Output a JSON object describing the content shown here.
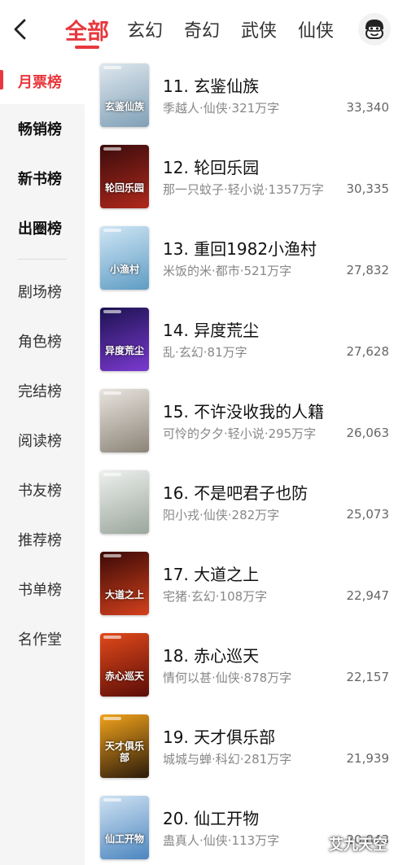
{
  "header": {
    "tabs": [
      {
        "label": "全部",
        "active": true
      },
      {
        "label": "玄幻",
        "active": false
      },
      {
        "label": "奇幻",
        "active": false
      },
      {
        "label": "武侠",
        "active": false
      },
      {
        "label": "仙侠",
        "active": false
      }
    ],
    "back_icon": "chevron-left-icon",
    "avatar_icon": "mascot-face-icon"
  },
  "sidebar": {
    "items": [
      {
        "label": "月票榜",
        "active": true,
        "bold": true
      },
      {
        "label": "畅销榜",
        "active": false,
        "bold": true
      },
      {
        "label": "新书榜",
        "active": false,
        "bold": true
      },
      {
        "label": "出圈榜",
        "active": false,
        "bold": true
      },
      {
        "label": "剧场榜",
        "active": false,
        "bold": false
      },
      {
        "label": "角色榜",
        "active": false,
        "bold": false
      },
      {
        "label": "完结榜",
        "active": false,
        "bold": false
      },
      {
        "label": "阅读榜",
        "active": false,
        "bold": false
      },
      {
        "label": "书友榜",
        "active": false,
        "bold": false
      },
      {
        "label": "推荐榜",
        "active": false,
        "bold": false
      },
      {
        "label": "书单榜",
        "active": false,
        "bold": false
      },
      {
        "label": "名作堂",
        "active": false,
        "bold": false
      }
    ]
  },
  "books": [
    {
      "title": "11. 玄鉴仙族",
      "meta": "季越人·仙侠·321万字",
      "votes": "33,340",
      "cover_text": "玄鉴仙族",
      "cover_colors": [
        "#dfe8ee",
        "#7f9fb6"
      ]
    },
    {
      "title": "12. 轮回乐园",
      "meta": "那一只蚊子·轻小说·1357万字",
      "votes": "30,335",
      "cover_text": "轮回乐园",
      "cover_colors": [
        "#3a0c0c",
        "#b0281c"
      ]
    },
    {
      "title": "13. 重回1982小渔村",
      "meta": "米饭的米·都市·521万字",
      "votes": "27,832",
      "cover_text": "小渔村",
      "cover_colors": [
        "#cfe6f5",
        "#5f9cc4"
      ]
    },
    {
      "title": "14. 异度荒尘",
      "meta": "乱·玄幻·81万字",
      "votes": "27,628",
      "cover_text": "异度荒尘",
      "cover_colors": [
        "#1c1250",
        "#7b3ad0"
      ]
    },
    {
      "title": "15. 不许没收我的人籍",
      "meta": "可怜的夕夕·轻小说·295万字",
      "votes": "26,063",
      "cover_text": "",
      "cover_colors": [
        "#e8e4de",
        "#8c8478"
      ]
    },
    {
      "title": "16. 不是吧君子也防",
      "meta": "阳小戎·仙侠·282万字",
      "votes": "25,073",
      "cover_text": "",
      "cover_colors": [
        "#eef0ee",
        "#9aa69c"
      ]
    },
    {
      "title": "17. 大道之上",
      "meta": "宅猪·玄幻·108万字",
      "votes": "22,947",
      "cover_text": "大道之上",
      "cover_colors": [
        "#3a0a06",
        "#d4401c"
      ]
    },
    {
      "title": "18. 赤心巡天",
      "meta": "情何以甚·仙侠·878万字",
      "votes": "22,157",
      "cover_text": "赤心巡天",
      "cover_colors": [
        "#e24a1a",
        "#5a0c08"
      ]
    },
    {
      "title": "19. 天才俱乐部",
      "meta": "城城与蝉·科幻·281万字",
      "votes": "21,939",
      "cover_text": "天才俱乐部",
      "cover_colors": [
        "#f2a31a",
        "#2a1a0c"
      ]
    },
    {
      "title": "20. 仙工开物",
      "meta": "蛊真人·仙侠·113万字",
      "votes": "20,843",
      "cover_text": "仙工开物",
      "cover_colors": [
        "#cfe2f2",
        "#4c86c0"
      ]
    }
  ],
  "watermark": "艾九天空"
}
